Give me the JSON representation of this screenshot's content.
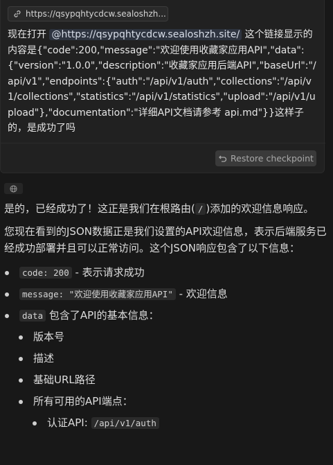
{
  "user_message": {
    "link_chip": "https://qsypqhtycdcw.sealoshzh...",
    "text_before": "现在打开 ",
    "mention": "@https://qsypqhtycdcw.sealoshzh.site/",
    "text_after": " 这个链接显示的内容是{\"code\":200,\"message\":\"欢迎使用收藏家应用API\",\"data\":{\"version\":\"1.0.0\",\"description\":\"收藏家应用后端API\",\"baseUrl\":\"/api/v1\",\"endpoints\":{\"auth\":\"/api/v1/auth\",\"collections\":\"/api/v1/collections\",\"statistics\":\"/api/v1/statistics\",\"upload\":\"/api/v1/upload\"},\"documentation\":\"详细API文档请参考 api.md\"}}这样子的，是成功了吗",
    "restore_label": "Restore checkpoint"
  },
  "assistant": {
    "p1_before": "是的，已经成功了！这正是我们在根路由(",
    "p1_code": "/",
    "p1_after": ")添加的欢迎信息响应。",
    "p2": "您现在看到的JSON数据正是我们设置的API欢迎信息，表示后端服务已经成功部署并且可以正常访问。这个JSON响应包含了以下信息：",
    "bullets": [
      {
        "code": "code: 200",
        "text": " - 表示请求成功"
      },
      {
        "code": "message: \"欢迎使用收藏家应用API\"",
        "text": " - 欢迎信息"
      },
      {
        "code": "data",
        "text": " 包含了API的基本信息："
      }
    ],
    "sub_bullets": [
      "版本号",
      "描述",
      "基础URL路径",
      "所有可用的API端点："
    ],
    "sub_sub_bullets": [
      {
        "text": "认证API: ",
        "code": "/api/v1/auth"
      }
    ]
  },
  "icons": {
    "link": "link-icon",
    "restore": "undo-icon",
    "globe": "globe-icon"
  }
}
